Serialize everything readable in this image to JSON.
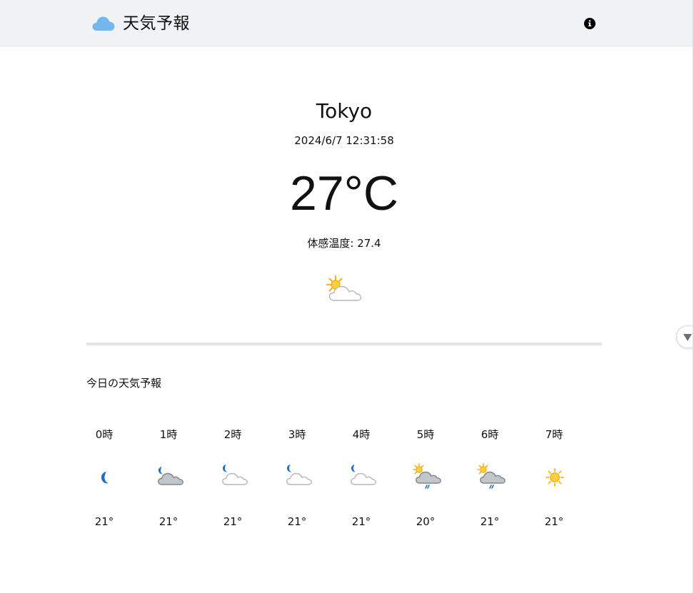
{
  "header": {
    "title": "天気予報",
    "logo_icon": "cloud-icon",
    "info_icon": "info-icon"
  },
  "current": {
    "city": "Tokyo",
    "datetime": "2024/6/7 12:31:58",
    "temperature": "27°C",
    "feels_like": "体感温度: 27.4",
    "condition_icon": "sun-behind-cloud-icon"
  },
  "forecast": {
    "title": "今日の天気予報",
    "hours": [
      {
        "label": "0時",
        "temp": "21°",
        "icon": "moon-icon"
      },
      {
        "label": "1時",
        "temp": "21°",
        "icon": "moon-cloud-icon"
      },
      {
        "label": "2時",
        "temp": "21°",
        "icon": "moon-cloud-icon"
      },
      {
        "label": "3時",
        "temp": "21°",
        "icon": "moon-cloud-icon"
      },
      {
        "label": "4時",
        "temp": "21°",
        "icon": "moon-cloud-icon"
      },
      {
        "label": "5時",
        "temp": "20°",
        "icon": "sun-cloud-rain-icon"
      },
      {
        "label": "6時",
        "temp": "21°",
        "icon": "sun-cloud-rain-icon"
      },
      {
        "label": "7時",
        "temp": "21°",
        "icon": "sun-icon"
      }
    ]
  },
  "colors": {
    "header_bg": "#f1f2f4",
    "logo_cloud": "#76b6ee",
    "moon": "#1f6fc5",
    "sun": "#f7b21c",
    "cloud_dark": "#aeb4bb",
    "cloud_light": "#ffffff",
    "rain": "#2f6fb5",
    "divider": "#e3e4e6"
  }
}
